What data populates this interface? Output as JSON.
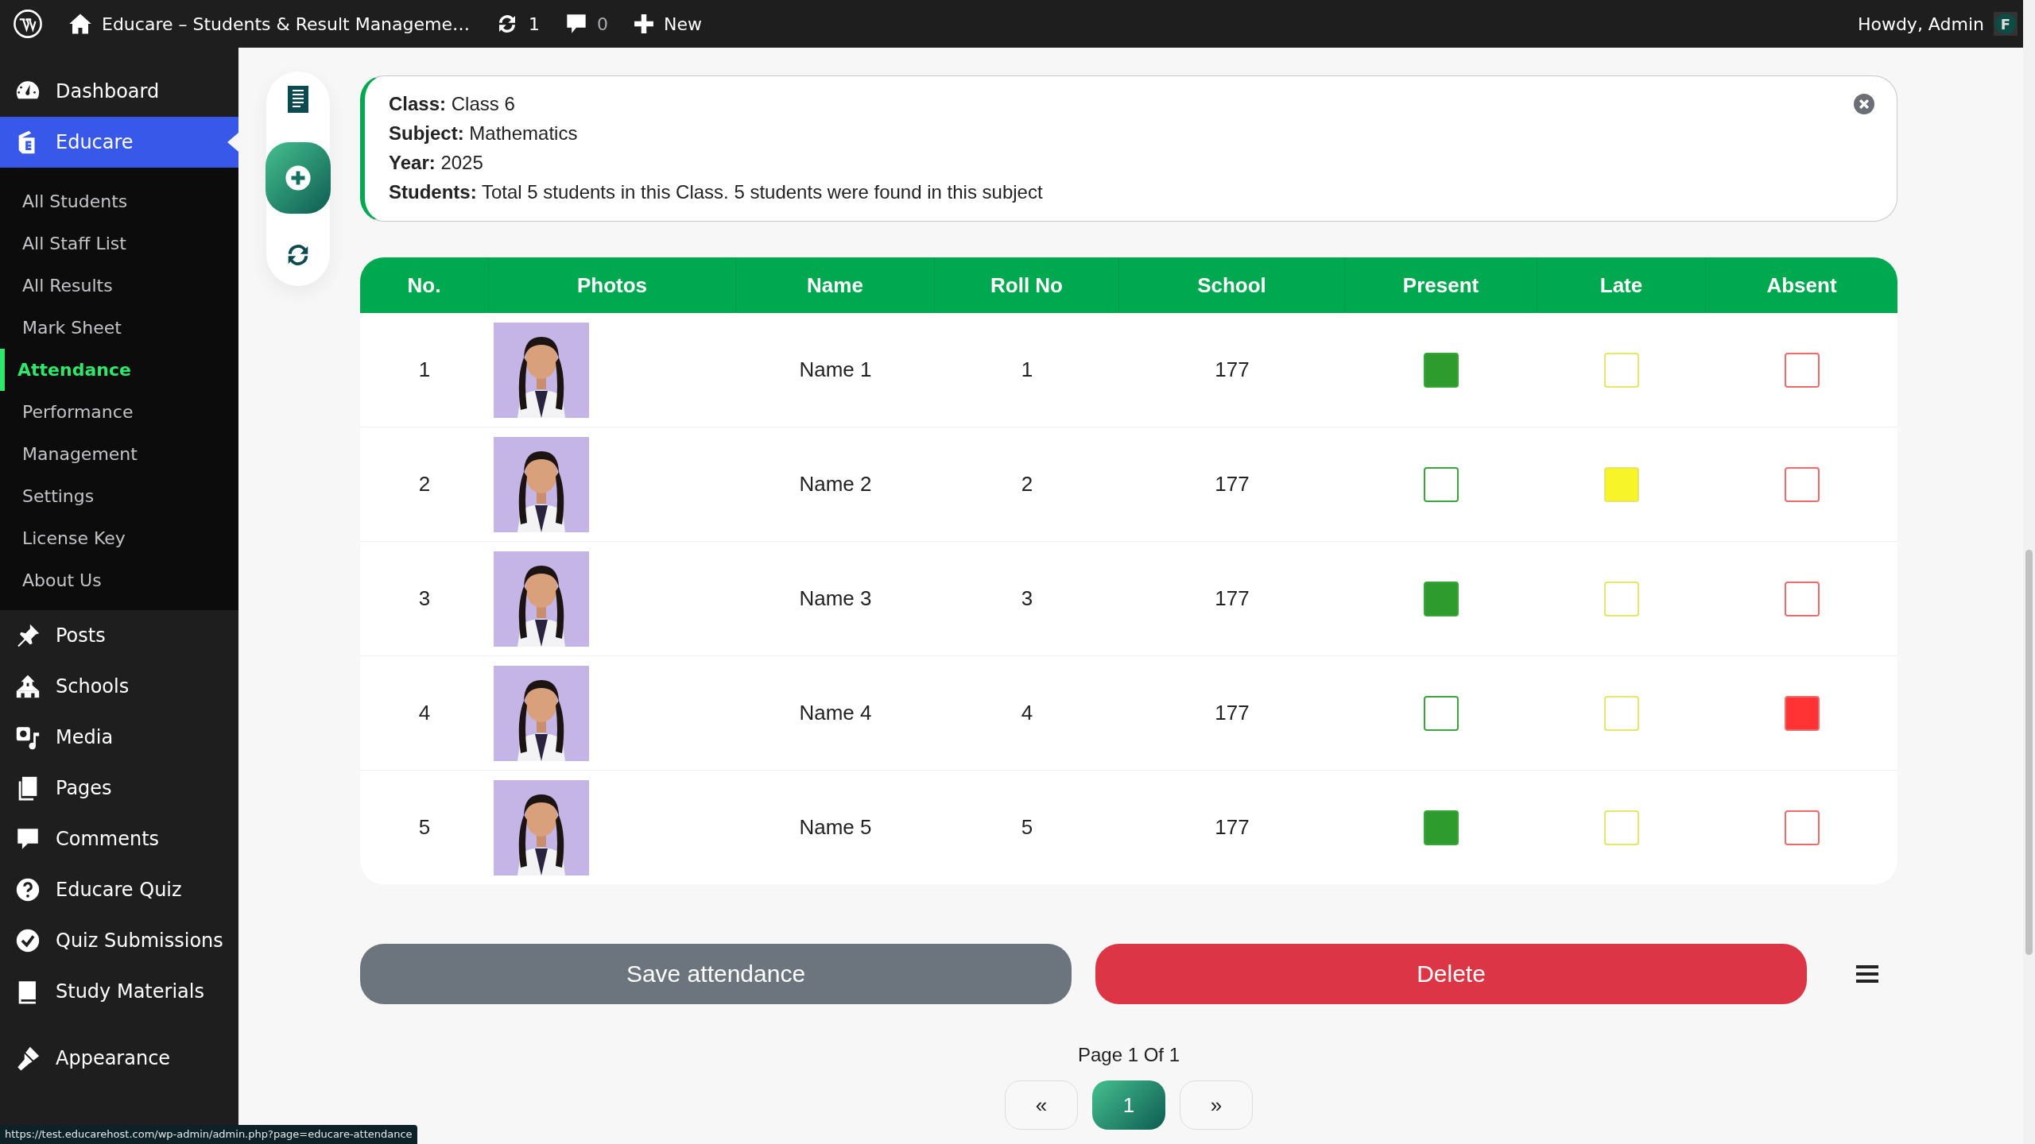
{
  "admin_bar": {
    "site_title": "Educare – Students & Result Manageme…",
    "updates": "1",
    "comments": "0",
    "new_label": "New",
    "greeting": "Howdy, Admin",
    "avatar_letter": "F"
  },
  "sidebar": {
    "items": [
      {
        "label": "Dashboard",
        "selected": false
      },
      {
        "label": "Educare",
        "selected": true,
        "children": [
          {
            "label": "All Students",
            "selected": false
          },
          {
            "label": "All Staff List",
            "selected": false
          },
          {
            "label": "All Results",
            "selected": false
          },
          {
            "label": "Mark Sheet",
            "selected": false
          },
          {
            "label": "Attendance",
            "selected": true
          },
          {
            "label": "Performance",
            "selected": false
          },
          {
            "label": "Management",
            "selected": false
          },
          {
            "label": "Settings",
            "selected": false
          },
          {
            "label": "License Key",
            "selected": false
          },
          {
            "label": "About Us",
            "selected": false
          }
        ]
      },
      {
        "label": "Posts",
        "selected": false
      },
      {
        "label": "Schools",
        "selected": false
      },
      {
        "label": "Media",
        "selected": false
      },
      {
        "label": "Pages",
        "selected": false
      },
      {
        "label": "Comments",
        "selected": false
      },
      {
        "label": "Educare Quiz",
        "selected": false
      },
      {
        "label": "Quiz Submissions",
        "selected": false
      },
      {
        "label": "Study Materials",
        "selected": false
      },
      {
        "label": "Appearance",
        "selected": false
      }
    ]
  },
  "info": {
    "lines": [
      "**Class:** Class 6",
      "**Subject:** Mathematics",
      "**Year:** 2025",
      "**Students:** Total 5 students in this Class. 5 students were found in this subject"
    ]
  },
  "table": {
    "columns": [
      "No.",
      "Photos",
      "Name",
      "Roll No",
      "School",
      "Present",
      "Late",
      "Absent"
    ],
    "rows": [
      {
        "no": "1",
        "name": "Name 1",
        "roll_no": "1",
        "school": "177",
        "present": true,
        "late": false,
        "absent": false
      },
      {
        "no": "2",
        "name": "Name 2",
        "roll_no": "2",
        "school": "177",
        "present": false,
        "late": true,
        "absent": false
      },
      {
        "no": "3",
        "name": "Name 3",
        "roll_no": "3",
        "school": "177",
        "present": true,
        "late": false,
        "absent": false
      },
      {
        "no": "4",
        "name": "Name 4",
        "roll_no": "4",
        "school": "177",
        "present": false,
        "late": false,
        "absent": true
      },
      {
        "no": "5",
        "name": "Name 5",
        "roll_no": "5",
        "school": "177",
        "present": true,
        "late": false,
        "absent": false
      }
    ]
  },
  "buttons": {
    "save": "Save attendance",
    "delete": "Delete"
  },
  "pagination": {
    "summary": "Page 1 Of 1",
    "prev": "«",
    "pages": [
      {
        "label": "1",
        "selected": true
      }
    ],
    "next": "»"
  },
  "status_url": "https://test.educarehost.com/wp-admin/admin.php?page=educare-attendance"
}
